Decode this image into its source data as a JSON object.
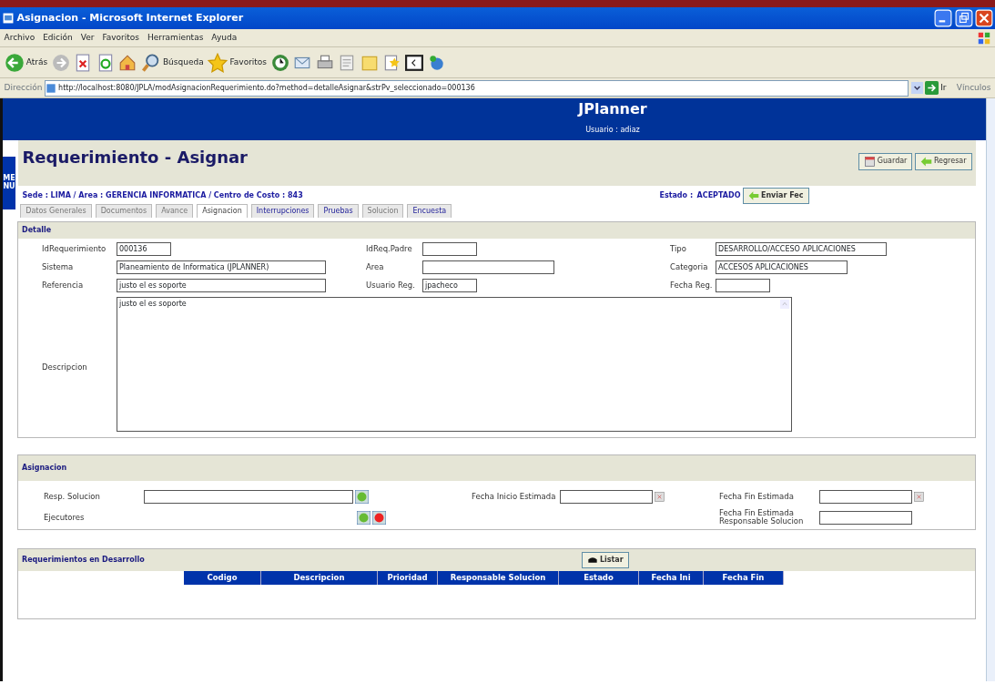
{
  "window": {
    "title": "Asignacion - Microsoft Internet Explorer"
  },
  "menu_bar": [
    "Archivo",
    "Edición",
    "Ver",
    "Favoritos",
    "Herramientas",
    "Ayuda"
  ],
  "toolbar": [
    {
      "kind": "back",
      "label": "Atrás"
    },
    {
      "kind": "forward"
    },
    {
      "kind": "stop"
    },
    {
      "kind": "refresh"
    },
    {
      "kind": "home"
    },
    {
      "kind": "search",
      "label": "Búsqueda"
    },
    {
      "kind": "favorites",
      "label": "Favoritos"
    },
    {
      "kind": "history"
    },
    {
      "kind": "mail"
    },
    {
      "kind": "print"
    },
    {
      "kind": "edit"
    },
    {
      "kind": "folder"
    },
    {
      "kind": "star"
    },
    {
      "kind": "window"
    },
    {
      "kind": "globe"
    }
  ],
  "address_bar": {
    "label": "Dirección",
    "url": "http://localhost:8080/JPLA/modAsignacionRequerimiento.do?method=detalleAsignar&strPv_seleccionado=000136",
    "go": "Ir",
    "links": "Vínculos"
  },
  "app_header": {
    "title": "JPlanner",
    "user": "Usuario : adiaz"
  },
  "side_tab": "MENU",
  "page": {
    "title": "Requerimiento - Asignar",
    "buttons": [
      {
        "kind": "save",
        "label": "Guardar"
      },
      {
        "kind": "back",
        "label": "Regresar"
      }
    ],
    "breadcrumb": "Sede : LIMA  /  Area : GERENCIA INFORMATICA  /  Centro de Costo : 843",
    "status_label": "Estado :",
    "status": "ACEPTADO",
    "send_button": "Enviar Fec"
  },
  "tabs": [
    {
      "label": "Datos Generales",
      "selected": false,
      "disabled": true
    },
    {
      "label": "Documentos",
      "selected": false,
      "disabled": true
    },
    {
      "label": "Avance",
      "selected": false,
      "disabled": true
    },
    {
      "label": "Asignacion",
      "selected": true,
      "disabled": false
    },
    {
      "label": "Interrupciones",
      "selected": false,
      "disabled": false
    },
    {
      "label": "Pruebas",
      "selected": false,
      "disabled": false
    },
    {
      "label": "Solucion",
      "selected": false,
      "disabled": true
    },
    {
      "label": "Encuesta",
      "selected": false,
      "disabled": false
    }
  ],
  "detalle": {
    "title": "Detalle",
    "fields": [
      {
        "label": "IdRequerimiento",
        "value": "000136"
      },
      {
        "label": "IdReq.Padre"
      },
      {
        "label": "Tipo",
        "value": "DESARROLLO/ACCESO APLICACIONES"
      },
      {
        "label": "Sistema",
        "value": "Planeamiento de Informatica (JPLANNER)"
      },
      {
        "label": "Area"
      },
      {
        "label": "Categoria",
        "value": "ACCESOS APLICACIONES"
      },
      {
        "label": "Referencia",
        "value": "justo el es soporte"
      },
      {
        "label": "Usuario Reg.",
        "value": "jpacheco"
      },
      {
        "label": "Fecha Reg."
      }
    ],
    "description": {
      "label": "Descripcion",
      "value": "justo el es soporte"
    }
  },
  "asignacion": {
    "title": "Asignacion",
    "fields": [
      {
        "label": "Resp. Solucion",
        "kind": "text_add"
      },
      {
        "label": "Fecha Inicio Estimada",
        "kind": "date"
      },
      {
        "label": "Fecha Fin Estimada",
        "kind": "date"
      },
      {
        "label": "Ejecutores",
        "kind": "add_remove"
      },
      {
        "kind": "blank"
      },
      {
        "label": "Fecha Fin Estimada Responsable Solucion",
        "kind": "text"
      }
    ]
  },
  "requerimientos": {
    "title": "Requerimientos en Desarrollo",
    "button": "Listar",
    "columns": [
      "Codigo",
      "Descripcion",
      "Prioridad",
      "Responsable Solucion",
      "Estado",
      "Fecha Ini",
      "Fecha Fin"
    ]
  }
}
